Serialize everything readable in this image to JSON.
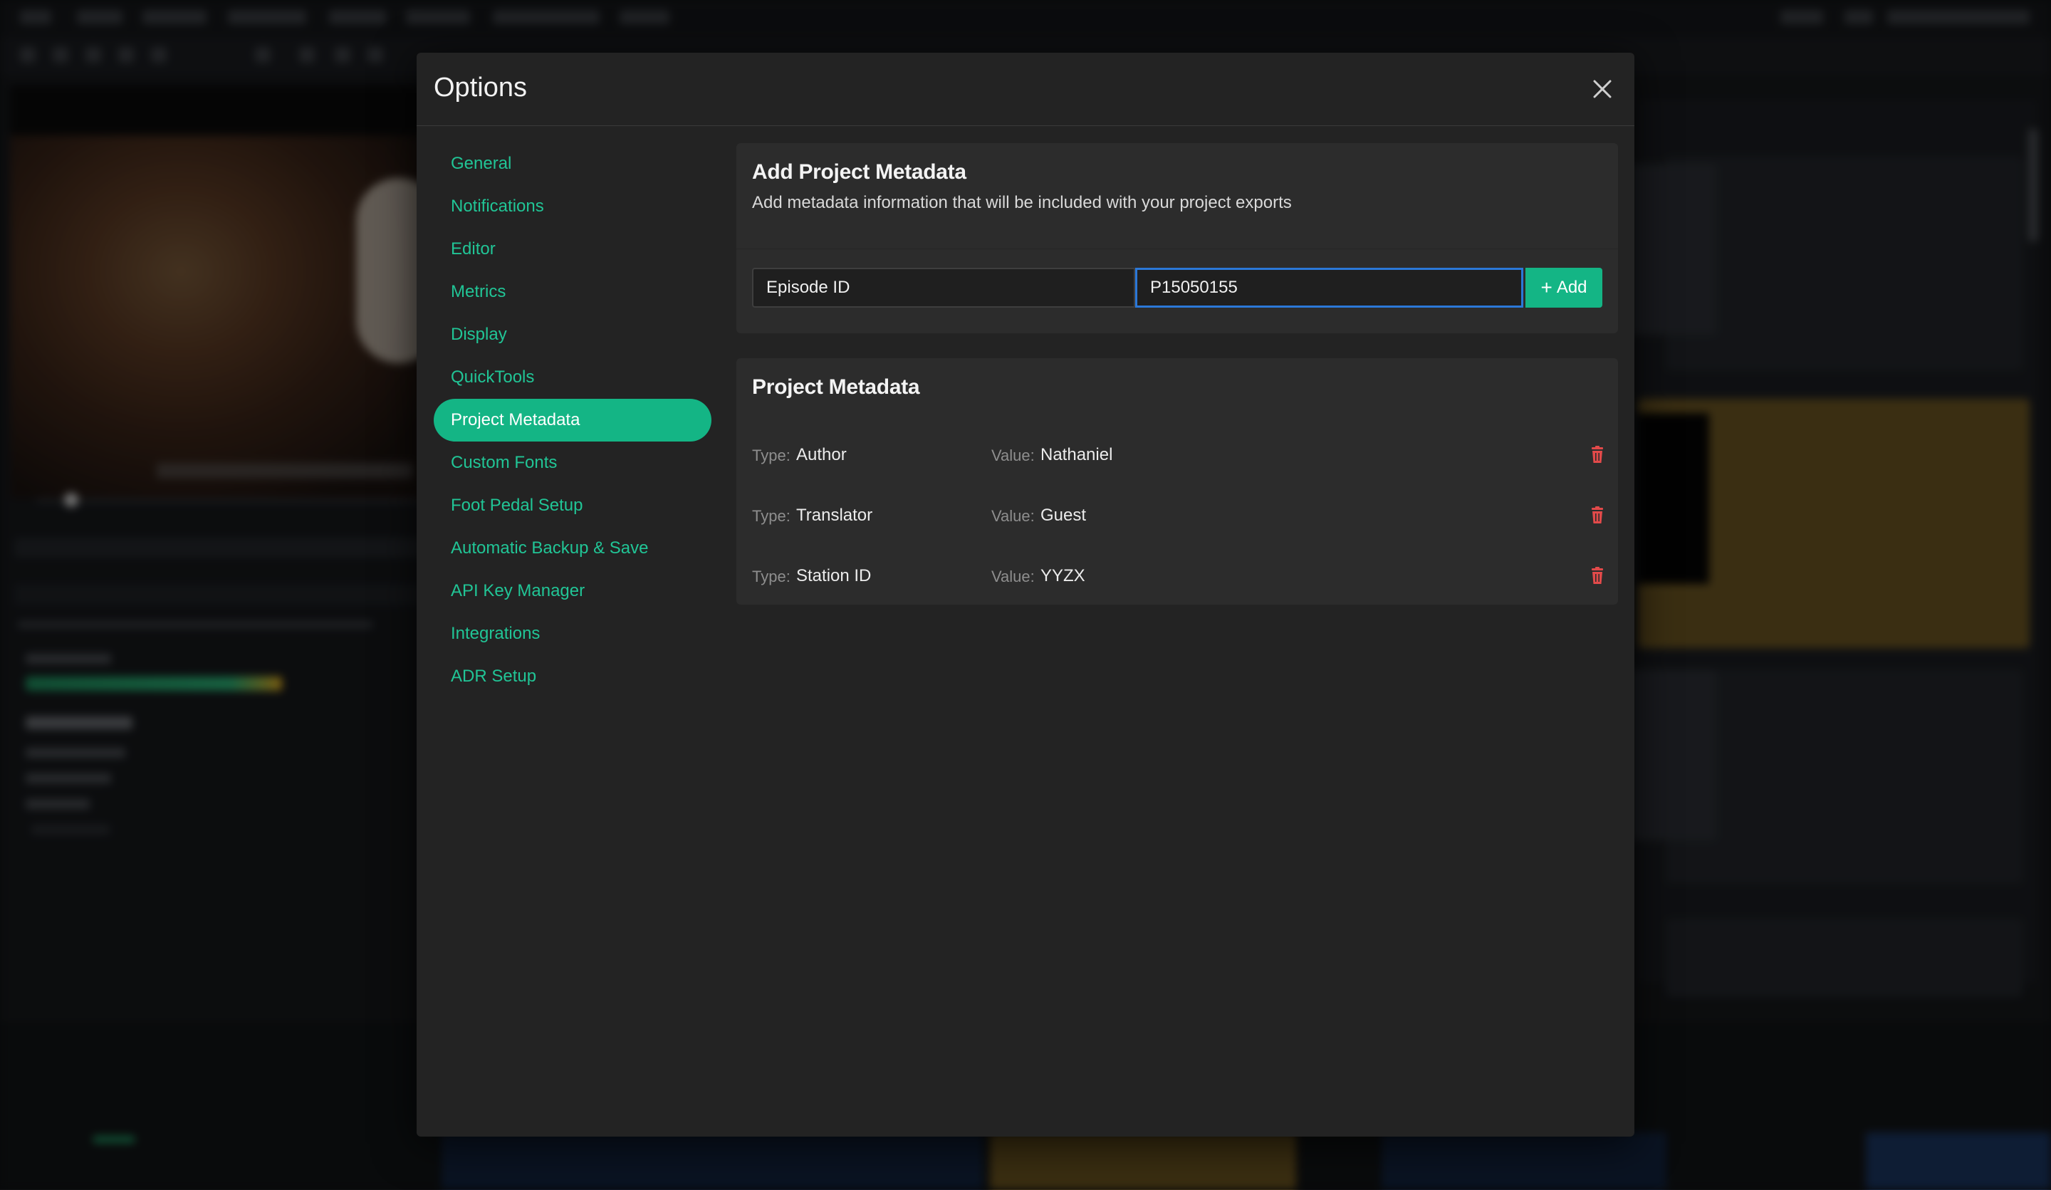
{
  "dialog": {
    "title": "Options"
  },
  "sidebar": {
    "items": [
      {
        "label": "General"
      },
      {
        "label": "Notifications"
      },
      {
        "label": "Editor"
      },
      {
        "label": "Metrics"
      },
      {
        "label": "Display"
      },
      {
        "label": "QuickTools"
      },
      {
        "label": "Project Metadata",
        "active": true
      },
      {
        "label": "Custom Fonts"
      },
      {
        "label": "Foot Pedal Setup"
      },
      {
        "label": "Automatic Backup & Save"
      },
      {
        "label": "API Key Manager"
      },
      {
        "label": "Integrations"
      },
      {
        "label": "ADR Setup"
      }
    ]
  },
  "add_metadata": {
    "title": "Add Project Metadata",
    "subtitle": "Add metadata information that will be included with your project exports",
    "key_value": "Episode ID",
    "value_value": "P15050155",
    "add_label": "Add",
    "add_icon": "plus-icon"
  },
  "project_metadata": {
    "title": "Project Metadata",
    "type_label": "Type:",
    "value_label": "Value:",
    "rows": [
      {
        "type": "Author",
        "value": "Nathaniel"
      },
      {
        "type": "Translator",
        "value": "Guest"
      },
      {
        "type": "Station ID",
        "value": "YYZX"
      }
    ],
    "delete_icon": "trash-icon"
  },
  "colors": {
    "accent": "#14b585",
    "accent_text": "#21c596",
    "focus_border": "#2b78d8",
    "delete": "#e24a4a",
    "modal_bg": "#232323",
    "panel_bg": "#2c2c2c"
  }
}
